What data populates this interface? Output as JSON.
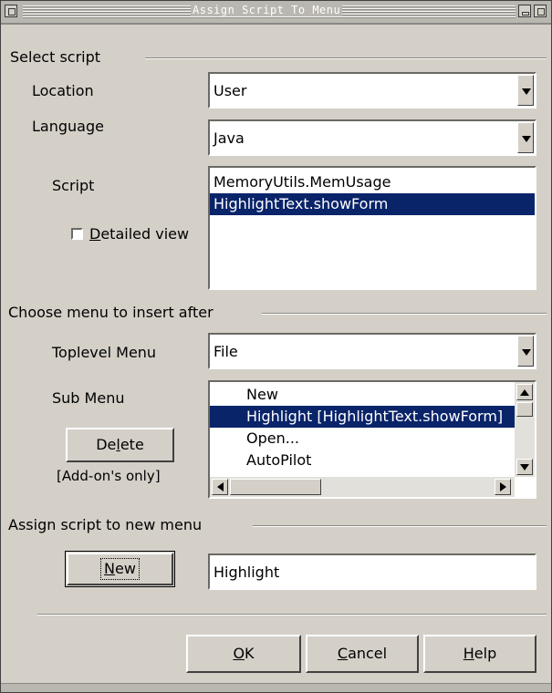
{
  "window": {
    "title": "Assign Script To Menu"
  },
  "select_script": {
    "group_label": "Select script",
    "location_label": "Location",
    "location_value": "User",
    "language_label": "Language",
    "language_value": "Java",
    "script_label": "Script",
    "detailed_view_label": "Detailed view",
    "detailed_view_mnemonic": "D",
    "detailed_view_rest": "etailed view",
    "detailed_view_checked": false,
    "scripts": [
      "MemoryUtils.MemUsage",
      "HighlightText.showForm"
    ],
    "selected_script_index": 1
  },
  "choose_menu": {
    "group_label": "Choose menu to insert after",
    "toplevel_label": "Toplevel Menu",
    "toplevel_value": "File",
    "submenu_label": "Sub Menu",
    "submenu_items": [
      "New",
      "Highlight [HighlightText.showForm]",
      "Open...",
      "AutoPilot"
    ],
    "selected_submenu_index": 1,
    "delete_button": {
      "pre": "De",
      "mnemonic": "l",
      "post": "ete"
    },
    "addons_note": "[Add-on's only]"
  },
  "new_menu": {
    "group_label": "Assign script to new menu",
    "new_button": {
      "mnemonic": "N",
      "post": "ew"
    },
    "name_value": "Highlight"
  },
  "footer": {
    "ok": {
      "mnemonic": "O",
      "post": "K"
    },
    "cancel": {
      "mnemonic": "C",
      "post": "ancel"
    },
    "help": {
      "mnemonic": "H",
      "post": "elp"
    }
  },
  "colors": {
    "dialog_bg": "#d4d0c8",
    "selection": "#0a246a",
    "titlebar": "#b9b7b0"
  }
}
